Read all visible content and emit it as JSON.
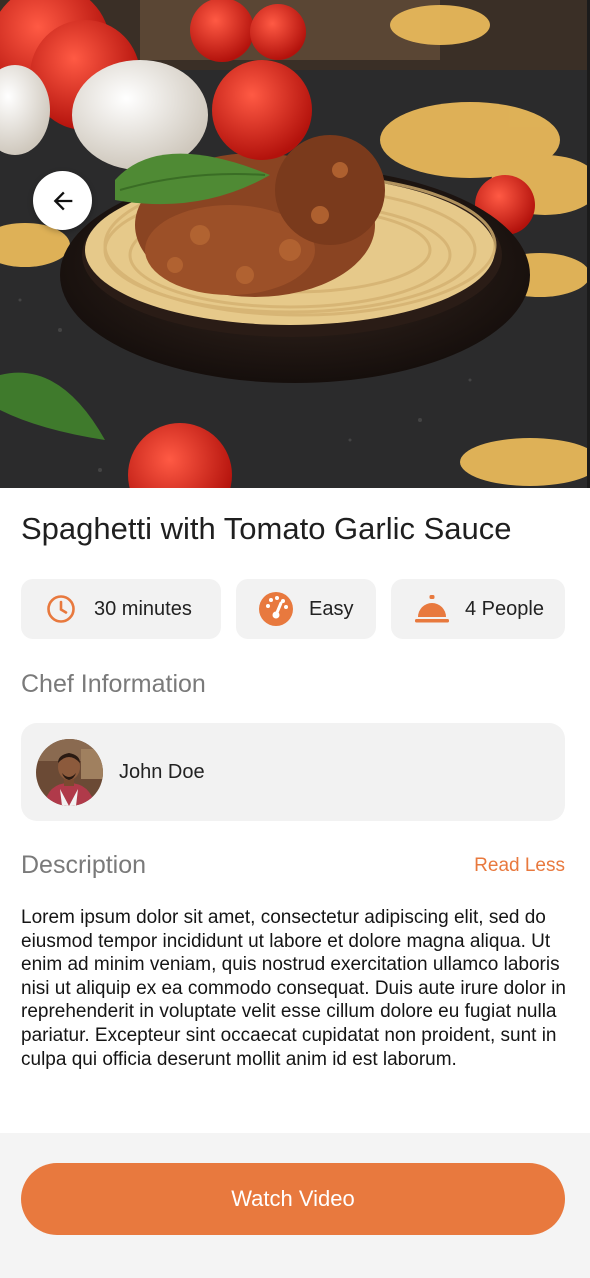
{
  "recipe": {
    "title": "Spaghetti with Tomato Garlic Sauce",
    "time": "30 minutes",
    "difficulty": "Easy",
    "servings": "4 People"
  },
  "icons": {
    "back": "arrow-left-icon",
    "time": "clock-icon",
    "difficulty": "gauge-icon",
    "servings": "serving-bell-icon"
  },
  "chef": {
    "heading": "Chef Information",
    "name": "John Doe"
  },
  "description": {
    "heading": "Description",
    "toggle_label": "Read Less",
    "text": "Lorem ipsum dolor sit amet, consectetur adipiscing elit, sed do eiusmod tempor incididunt ut labore et dolore magna aliqua. Ut enim ad minim veniam, quis nostrud exercitation ullamco laboris nisi ut aliquip ex ea commodo consequat. Duis aute irure dolor in reprehenderit in voluptate velit esse cillum dolore eu fugiat nulla pariatur. Excepteur sint occaecat cupidatat non proident, sunt in culpa qui officia deserunt mollit anim id est laborum."
  },
  "actions": {
    "watch_video": "Watch Video"
  },
  "colors": {
    "accent": "#e8793e",
    "chip_background": "#f2f2f2",
    "bottom_bar": "#f4f4f4"
  }
}
